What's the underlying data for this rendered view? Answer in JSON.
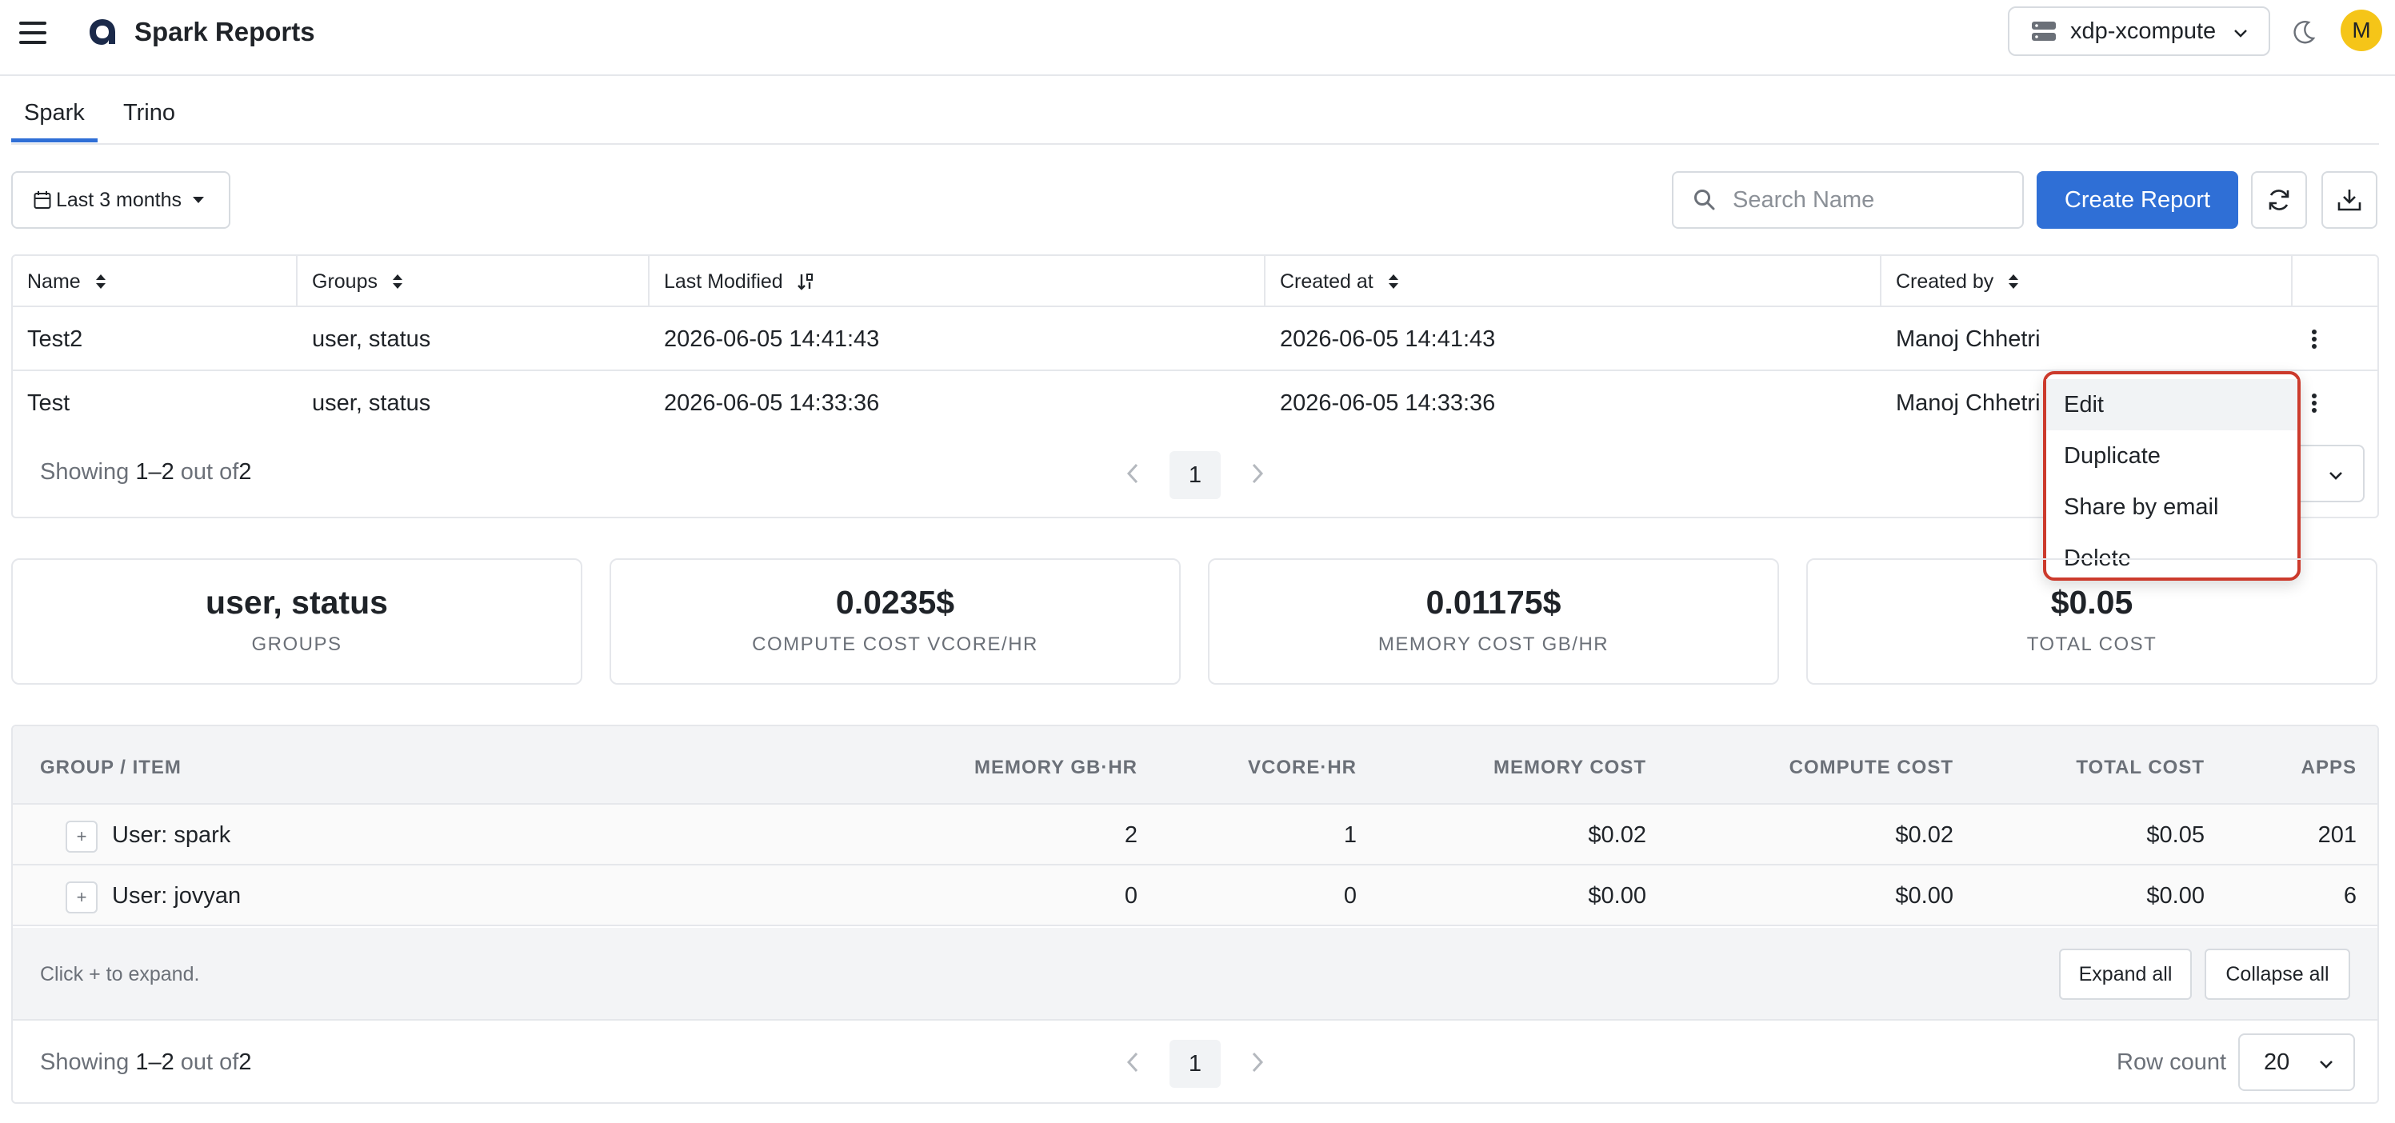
{
  "header": {
    "title": "Spark Reports",
    "cluster": "xdp-xcompute",
    "avatar_initial": "M"
  },
  "tabs": [
    {
      "label": "Spark",
      "active": true
    },
    {
      "label": "Trino",
      "active": false
    }
  ],
  "toolbar": {
    "date_range": "Last 3 months",
    "search_placeholder": "Search Name",
    "create_label": "Create Report"
  },
  "reports_table": {
    "columns": [
      "Name",
      "Groups",
      "Last Modified",
      "Created at",
      "Created by"
    ],
    "rows": [
      {
        "name": "Test2",
        "groups": "user, status",
        "last_modified": "2026-06-05 14:41:43",
        "created_at": "2026-06-05 14:41:43",
        "created_by": "Manoj Chhetri"
      },
      {
        "name": "Test",
        "groups": "user, status",
        "last_modified": "2026-06-05 14:33:36",
        "created_at": "2026-06-05 14:33:36",
        "created_by": "Manoj Chhetri"
      }
    ],
    "showing_prefix": "Showing",
    "showing_range": "1–2",
    "showing_mid": "out of",
    "showing_total": "2",
    "page": "1"
  },
  "context_menu": {
    "items": [
      "Edit",
      "Duplicate",
      "Share by email",
      "Delete"
    ]
  },
  "stats": [
    {
      "value": "user, status",
      "label": "GROUPS"
    },
    {
      "value": "0.0235$",
      "label": "COMPUTE COST VCORE/HR"
    },
    {
      "value": "0.01175$",
      "label": "MEMORY COST GB/HR"
    },
    {
      "value": "$0.05",
      "label": "TOTAL COST"
    }
  ],
  "breakdown": {
    "columns": [
      "GROUP / ITEM",
      "MEMORY GB·HR",
      "VCORE·HR",
      "MEMORY COST",
      "COMPUTE COST",
      "TOTAL COST",
      "APPS"
    ],
    "rows": [
      {
        "group": "User: spark",
        "memory_gb_hr": "2",
        "vcore_hr": "1",
        "memory_cost": "$0.02",
        "compute_cost": "$0.02",
        "total_cost": "$0.05",
        "apps": "201"
      },
      {
        "group": "User: jovyan",
        "memory_gb_hr": "0",
        "vcore_hr": "0",
        "memory_cost": "$0.00",
        "compute_cost": "$0.00",
        "total_cost": "$0.00",
        "apps": "6"
      }
    ],
    "expander_symbol": "+",
    "hint": "Click + to expand.",
    "expand_all": "Expand all",
    "collapse_all": "Collapse all",
    "showing_prefix": "Showing",
    "showing_range": "1–2",
    "showing_mid": "out of",
    "showing_total": "2",
    "page": "1",
    "row_count_label": "Row count",
    "row_count": "20"
  },
  "colors": {
    "accent": "#2f6fd6",
    "menu_highlight_border": "#cc3a2c",
    "avatar_bg": "#f5c518"
  }
}
